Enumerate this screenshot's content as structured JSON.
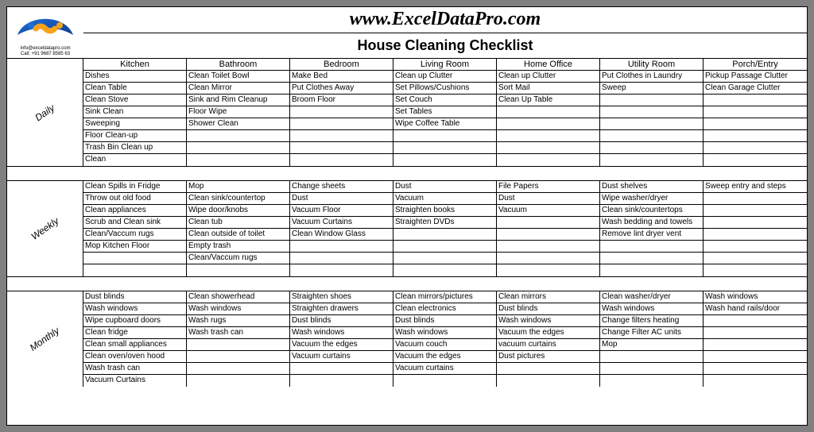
{
  "site_url": "www.ExcelDataPro.com",
  "doc_title": "House Cleaning Checklist",
  "contact_email": "info@exceldatapro.com",
  "contact_phone": "Call: +91 9687 8585 63",
  "columns": [
    "Kitchen",
    "Bathroom",
    "Bedroom",
    "Living Room",
    "Home Office",
    "Utility Room",
    "Porch/Entry"
  ],
  "sections": [
    {
      "period": "Daily",
      "rows": 8,
      "data": [
        [
          "Dishes",
          "Clean Toilet Bowl",
          "Make Bed",
          "Clean up Clutter",
          "Clean up Clutter",
          "Put Clothes in Laundry",
          "Pickup Passage Clutter"
        ],
        [
          "Clean Table",
          "Clean Mirror",
          "Put Clothes Away",
          "Set Pillows/Cushions",
          "Sort Mail",
          "Sweep",
          "Clean Garage Clutter"
        ],
        [
          "Clean Stove",
          "Sink and Rim Cleanup",
          "Broom Floor",
          "Set Couch",
          "Clean Up Table",
          "",
          ""
        ],
        [
          "Sink Clean",
          "Floor Wipe",
          "",
          "Set Tables",
          "",
          "",
          ""
        ],
        [
          "Sweeping",
          "Shower Clean",
          "",
          "Wipe Coffee Table",
          "",
          "",
          ""
        ],
        [
          "Floor Clean-up",
          "",
          "",
          "",
          "",
          "",
          ""
        ],
        [
          "Trash Bin Clean up",
          "",
          "",
          "",
          "",
          "",
          ""
        ],
        [
          "Clean",
          "",
          "",
          "",
          "",
          "",
          ""
        ]
      ]
    },
    {
      "period": "Weekly",
      "rows": 8,
      "data": [
        [
          "Clean Spills in Fridge",
          "Mop",
          "Change sheets",
          "Dust",
          "File Papers",
          "Dust shelves",
          "Sweep entry and steps"
        ],
        [
          "Throw out old food",
          "Clean sink/countertop",
          "Dust",
          "Vacuum",
          "Dust",
          "Wipe washer/dryer",
          ""
        ],
        [
          "Clean appliances",
          "Wipe door/knobs",
          "Vacuum Floor",
          "Straighten books",
          "Vacuum",
          "Clean sink/countertops",
          ""
        ],
        [
          "Scrub and Clean sink",
          "Clean tub",
          "Vacuum Curtains",
          "Straighten DVDs",
          "",
          "Wash bedding and towels",
          ""
        ],
        [
          "Clean/Vaccum rugs",
          "Clean outside of toilet",
          "Clean Window Glass",
          "",
          "",
          "Remove lint dryer vent",
          ""
        ],
        [
          "Mop Kitchen Floor",
          "Empty trash",
          "",
          "",
          "",
          "",
          ""
        ],
        [
          "",
          "Clean/Vaccum rugs",
          "",
          "",
          "",
          "",
          ""
        ],
        [
          "",
          "",
          "",
          "",
          "",
          "",
          ""
        ]
      ]
    },
    {
      "period": "Monthly",
      "rows": 8,
      "data": [
        [
          "Dust blinds",
          "Clean showerhead",
          "Straighten shoes",
          "Clean mirrors/pictures",
          "Clean mirrors",
          "Clean washer/dryer",
          "Wash windows"
        ],
        [
          "Wash windows",
          "Wash windows",
          "Straighten drawers",
          "Clean electronics",
          "Dust blinds",
          "Wash windows",
          "Wash hand rails/door"
        ],
        [
          "Wipe cupboard doors",
          "Wash rugs",
          "Dust blinds",
          "Dust blinds",
          "Wash windows",
          "Change filters heating",
          ""
        ],
        [
          "Clean fridge",
          "Wash trash can",
          "Wash windows",
          "Wash windows",
          "Vacuum the edges",
          "Change Filter AC units",
          ""
        ],
        [
          "Clean small appliances",
          "",
          "Vacuum the edges",
          "Vacuum couch",
          "vacuum curtains",
          "Mop",
          ""
        ],
        [
          "Clean oven/oven hood",
          "",
          "Vacuum curtains",
          "Vacuum the edges",
          "Dust pictures",
          "",
          ""
        ],
        [
          "Wash trash can",
          "",
          "",
          "Vacuum curtains",
          "",
          "",
          ""
        ],
        [
          "Vacuum Curtains",
          "",
          "",
          "",
          "",
          "",
          ""
        ]
      ]
    }
  ]
}
